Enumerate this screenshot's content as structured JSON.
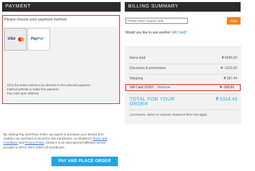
{
  "payment": {
    "header": "PAYMENT",
    "prompt": "Please choose your payment method",
    "methods": [
      {
        "name": "Visa / Mastercard",
        "visa_text": "VISA",
        "selected": true
      },
      {
        "name": "PayPal",
        "text_p": "Pay",
        "text_pal": "Pal",
        "selected": false
      }
    ],
    "instructions": [
      "Click the button below to be directed to the selected payment",
      "method website to make this payment",
      "Pay cash upon delivery"
    ]
  },
  "disclaimer": {
    "line1": "By clicking Pay and Place Order, you agree to purchase your item(s) from",
    "line2_pre": "Global-e as merchant of record for this transaction, on Global-e's ",
    "line2_link": "Terms and",
    "line3_link1": "Conditions",
    "line3_mid": " and ",
    "line3_link2": "Privacy Policy",
    "line3_post": ". Global-e is an international fulfilment service",
    "line4": "provider to SFCC DEV (GBP) All Sandboxes."
  },
  "place_order_label": "PAY AND PLACE ORDER",
  "billing": {
    "header": "BILLING SUMMARY",
    "coupon_placeholder": "Please enter coupon code",
    "apply_label": "Apply",
    "giftcard_question": "Would you like to use another ",
    "giftcard_link": "Gift Card?",
    "rows": [
      {
        "label": "Items total",
        "amount": "₴ 6596.00"
      },
      {
        "label": "Discounts & promotions",
        "amount": "₴ -1319.20"
      },
      {
        "label": "Shipping",
        "amount": "₴ 397.44"
      }
    ],
    "giftcard_row": {
      "label": "Gift Card 15257... ",
      "remove": "Remove",
      "amount": "₴ -359.81"
    },
    "total_label_line1": "TOTAL FOR YOUR",
    "total_label_line2": "ORDER",
    "total_amount": "₴ 5314.43",
    "tax_note": "Local taxes, duties or customs clearance fees may apply"
  },
  "colors": {
    "accent_blue": "#1ea7e1",
    "highlight_red": "#e0252d",
    "apply_orange": "#f5821f",
    "header_dark": "#2b2b2b"
  }
}
